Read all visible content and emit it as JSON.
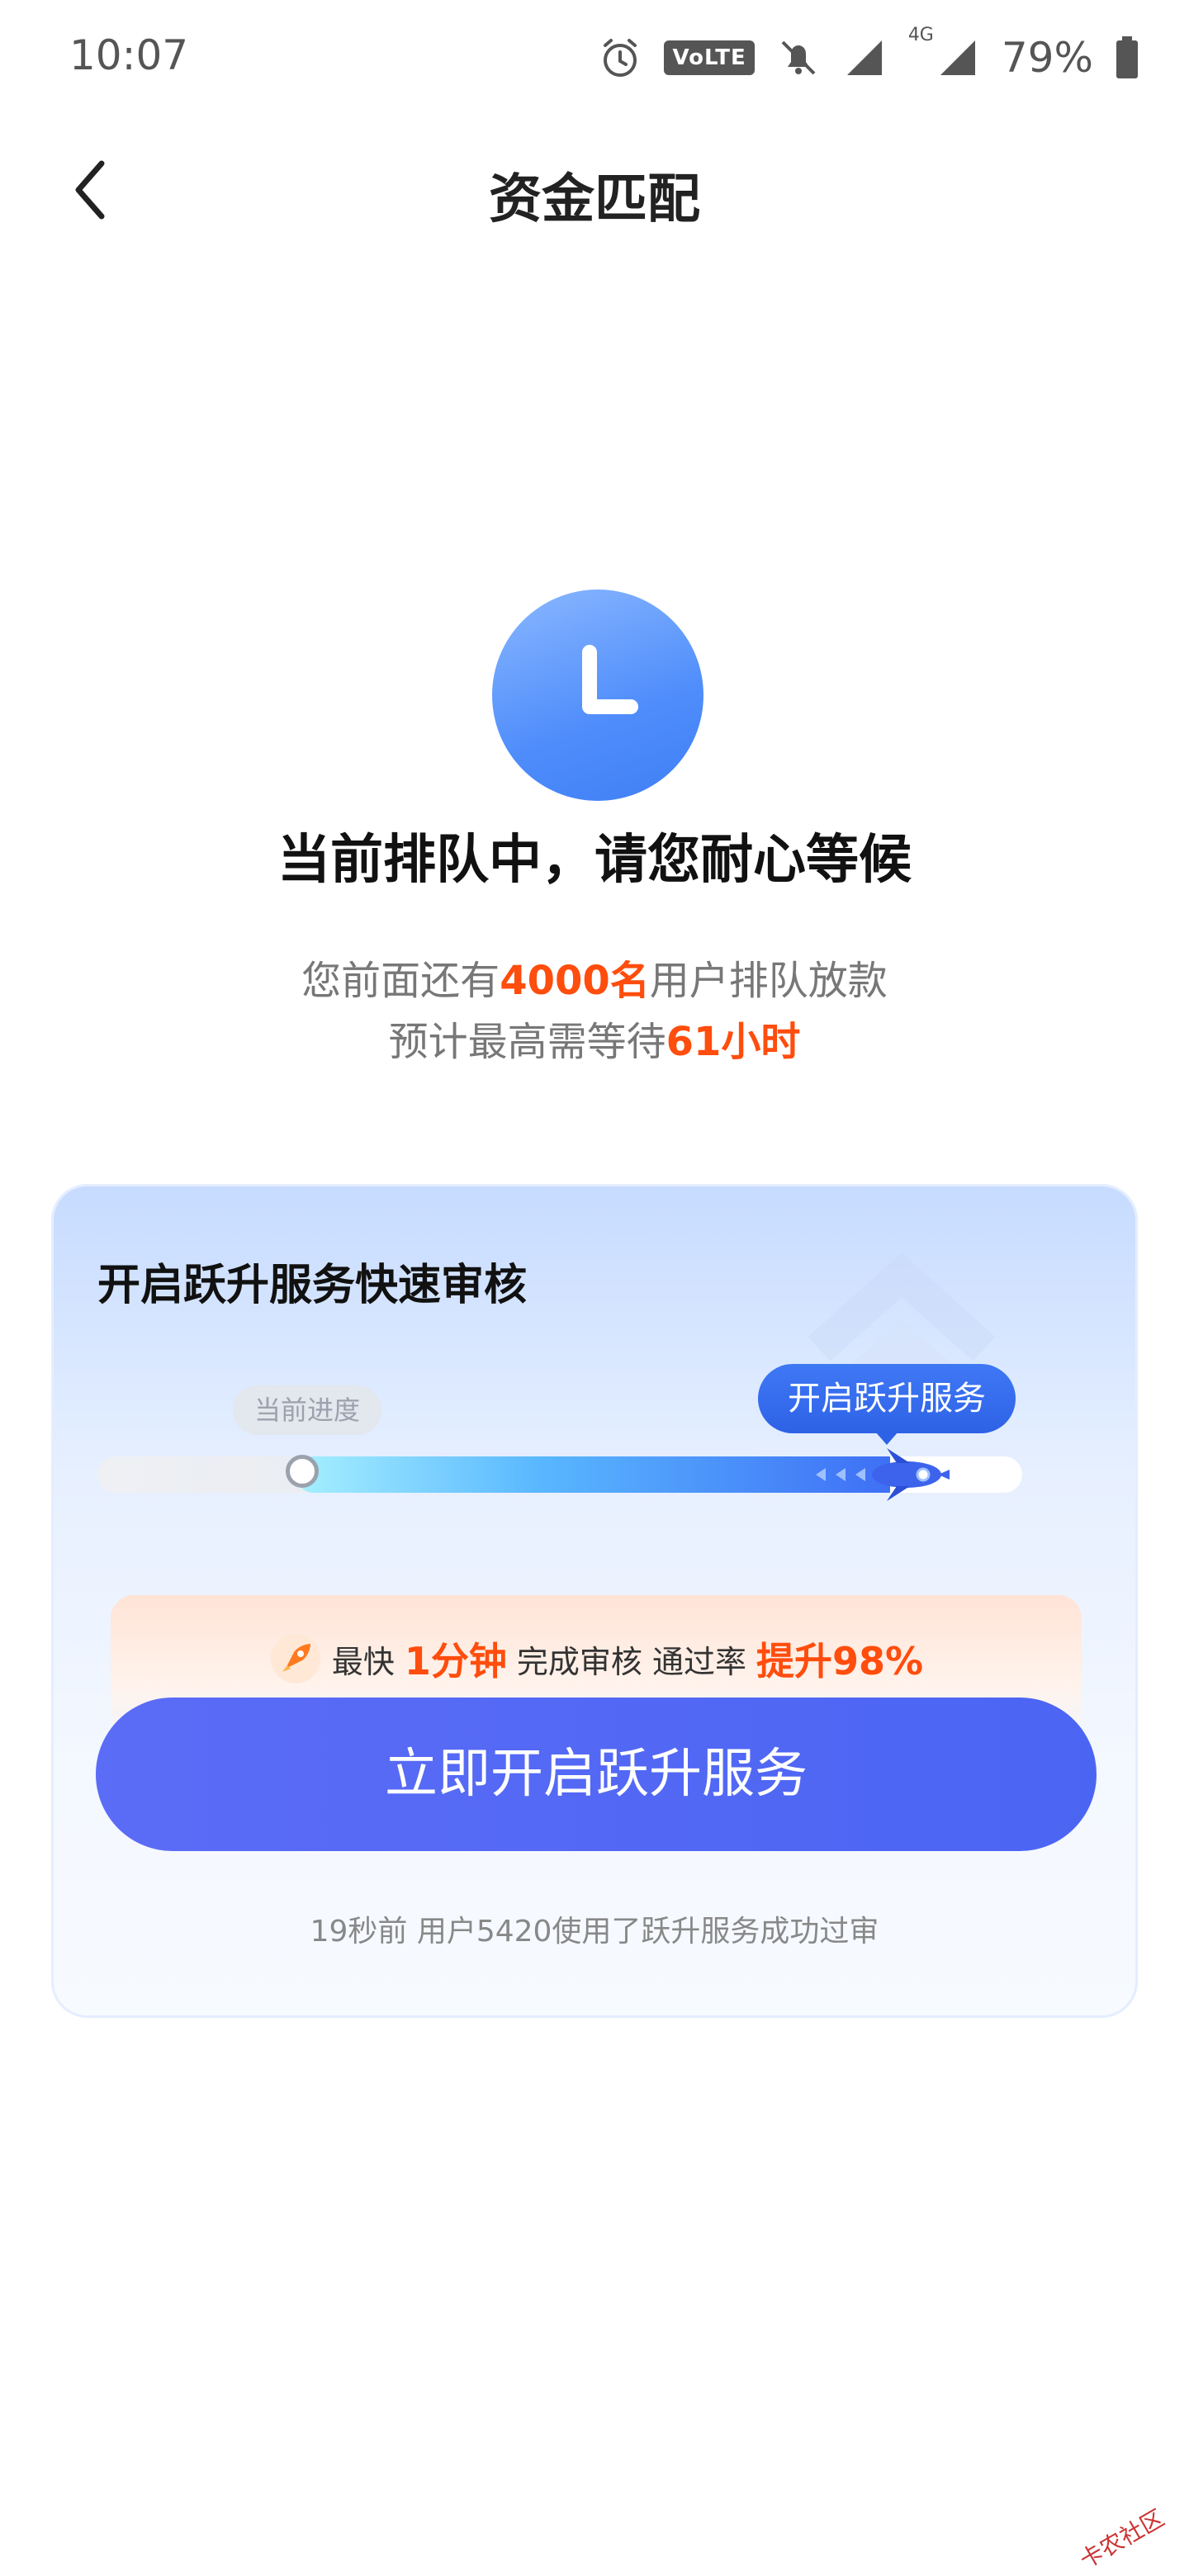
{
  "status_bar": {
    "time": "10:07",
    "volte": "VoLTE",
    "network": "4G",
    "battery": "79%"
  },
  "header": {
    "title": "资金匹配"
  },
  "queue": {
    "title": "当前排队中，请您耐心等候",
    "line1_prefix": "您前面还有",
    "line1_count": "4000名",
    "line1_suffix": "用户排队放款",
    "line2_prefix": "预计最高需等待",
    "line2_time": "61小时"
  },
  "card": {
    "title": "开启跃升服务快速审核",
    "tag_current": "当前进度",
    "tag_boost": "开启跃升服务",
    "progress_percent": 20,
    "promo": {
      "p1": "最快",
      "p2": "1分钟",
      "p3": "完成审核 通过率",
      "p4": "提升98%"
    },
    "cta_label": "立即开启跃升服务",
    "ticker": "19秒前 用户5420使用了跃升服务成功过审"
  },
  "watermark": "卡农社区",
  "colors": {
    "accent_blue": "#4b65f3",
    "highlight_orange": "#ff4d0d"
  }
}
